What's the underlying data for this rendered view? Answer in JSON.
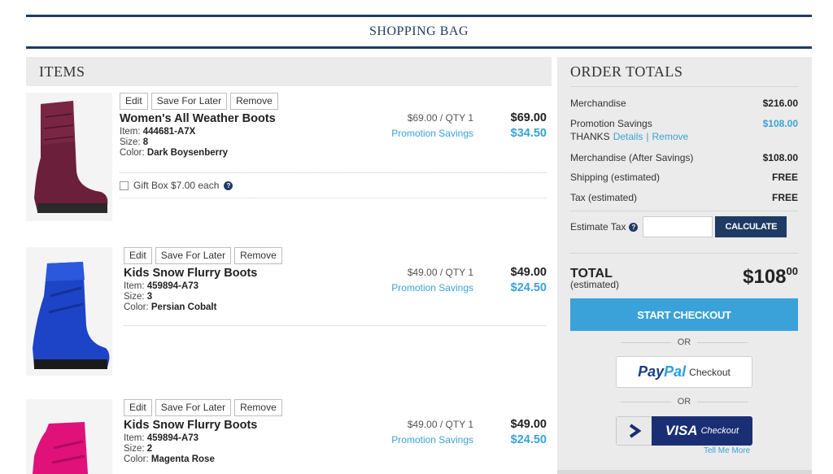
{
  "header": {
    "title": "SHOPPING BAG"
  },
  "items_section": {
    "title": "ITEMS"
  },
  "buttons": {
    "edit": "Edit",
    "save_later": "Save For Later",
    "remove": "Remove"
  },
  "items": [
    {
      "name": "Women's All Weather Boots",
      "item_label": "Item:",
      "item_no": "444681-A7X",
      "size_label": "Size:",
      "size": "8",
      "color_label": "Color:",
      "color": "Dark Boysenberry",
      "unit_price": "$69.00 / QTY 1",
      "promo_label": "Promotion Savings",
      "total": "$69.00",
      "savings": "$34.50",
      "gift_box": "Gift Box $7.00 each",
      "product_color": "#6b1f3a"
    },
    {
      "name": "Kids Snow Flurry Boots",
      "item_label": "Item:",
      "item_no": "459894-A73",
      "size_label": "Size:",
      "size": "3",
      "color_label": "Color:",
      "color": "Persian Cobalt",
      "unit_price": "$49.00 / QTY 1",
      "promo_label": "Promotion Savings",
      "total": "$49.00",
      "savings": "$24.50",
      "product_color": "#1d44c7"
    },
    {
      "name": "Kids Snow Flurry Boots",
      "item_label": "Item:",
      "item_no": "459894-A73",
      "size_label": "Size:",
      "size": "2",
      "color_label": "Color:",
      "color": "Magenta Rose",
      "unit_price": "$49.00 / QTY 1",
      "promo_label": "Promotion Savings",
      "total": "$49.00",
      "savings": "$24.50",
      "product_color": "#e0127a"
    }
  ],
  "order_totals": {
    "title": "ORDER TOTALS",
    "merchandise_label": "Merchandise",
    "merchandise_value": "$216.00",
    "promo_label": "Promotion Savings",
    "promo_value": "$108.00",
    "promo_code": "THANKS",
    "details_link": "Details",
    "separator": "|",
    "remove_link": "Remove",
    "after_label": "Merchandise (After Savings)",
    "after_value": "$108.00",
    "shipping_label": "Shipping (estimated)",
    "shipping_value": "FREE",
    "tax_label": "Tax (estimated)",
    "tax_value": "FREE",
    "estimate_label": "Estimate Tax",
    "estimate_input_value": "",
    "calculate_label": "CALCULATE",
    "total_label": "TOTAL",
    "total_sub": "(estimated)",
    "total_dollars": "$108",
    "total_cents": "00",
    "checkout_label": "START CHECKOUT",
    "or_label": "OR",
    "paypal_word1": "Pay",
    "paypal_word2": "Pal",
    "paypal_checkout": "Checkout",
    "visa_word": "VISA",
    "visa_checkout": "Checkout",
    "tell_more": "Tell Me More"
  },
  "colors": {
    "navy": "#1f3b64",
    "accent_blue": "#3aa2d8",
    "panel_gray": "#ebebeb"
  },
  "icons": {
    "help": "question-circle-icon",
    "visa_arrow": "chevron-right-icon"
  }
}
